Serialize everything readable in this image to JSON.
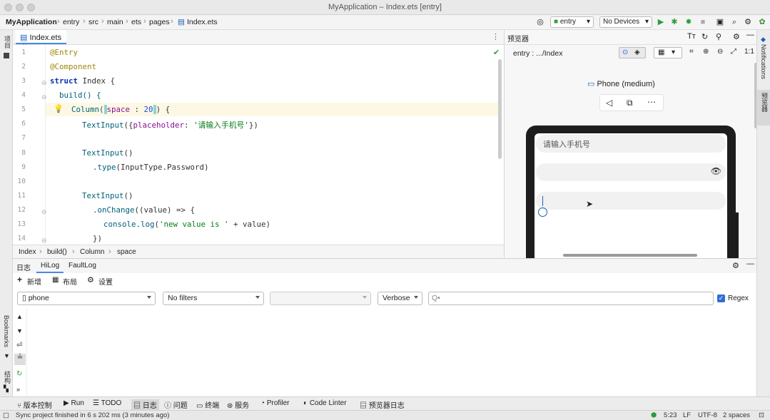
{
  "window": {
    "title": "MyApplication – Index.ets [entry]"
  },
  "nav": {
    "crumbs": [
      "MyApplication",
      "entry",
      "src",
      "main",
      "ets",
      "pages",
      "Index.ets"
    ],
    "module_select": "entry",
    "device_select": "No Devices"
  },
  "left_strip": {
    "top_label": "项目",
    "bookmarks": "Bookmarks",
    "structure": "结构"
  },
  "right_strip": {
    "notifications": "Notifications",
    "previewer": "预览器"
  },
  "editor": {
    "tab": "Index.ets",
    "lines": [
      "1",
      "2",
      "3",
      "4",
      "5",
      "6",
      "7",
      "8",
      "9",
      "10",
      "11",
      "12",
      "13",
      "14"
    ],
    "code": {
      "l1": "@Entry",
      "l2": "@Component",
      "l3_kw": "struct",
      "l3_rest": " Index {",
      "l4": "  build() {",
      "l5_fn": "Column(",
      "l5_prop": "space",
      "l5_mid": " : ",
      "l5_num": "20",
      "l5_end": ") {",
      "l6_fn": "TextInput",
      "l6_open": "({",
      "l6_prop": "placeholder",
      "l6_colon": ": ",
      "l6_str": "'请输入手机号'",
      "l6_close": "})",
      "l8_fn": "TextInput",
      "l8_rest": "()",
      "l9_fn": ".type",
      "l9_rest": "(InputType.Password)",
      "l11_fn": "TextInput",
      "l11_rest": "()",
      "l12_fn": ".onChange",
      "l12_rest": "((value) => {",
      "l13_fn": "console.log",
      "l13_open": "(",
      "l13_str": "'new value is '",
      "l13_rest": " + value)",
      "l14": "})"
    },
    "breadcrumb": [
      "Index",
      "build()",
      "Column",
      "space"
    ]
  },
  "preview": {
    "title": "预览器",
    "path": "entry : .../Index",
    "device": "Phone (medium)",
    "input1_placeholder": "请输入手机号"
  },
  "log": {
    "tabs": [
      "日志",
      "HiLog",
      "FaultLog"
    ],
    "actions": [
      "新增",
      "布局",
      "设置"
    ],
    "device_filter": "phone",
    "filter": "No filters",
    "level": "Verbose",
    "search_placeholder": "Q•",
    "regex_label": "Regex",
    "regex_checked": true
  },
  "bottom_tools": [
    "版本控制",
    "Run",
    "TODO",
    "日志",
    "问题",
    "终端",
    "服务",
    "Profiler",
    "Code Linter",
    "预览器日志"
  ],
  "status": {
    "message": "Sync project finished in 6 s 202 ms (3 minutes ago)",
    "position": "5:23",
    "line_sep": "LF",
    "encoding": "UTF-8",
    "indent": "2 spaces"
  }
}
